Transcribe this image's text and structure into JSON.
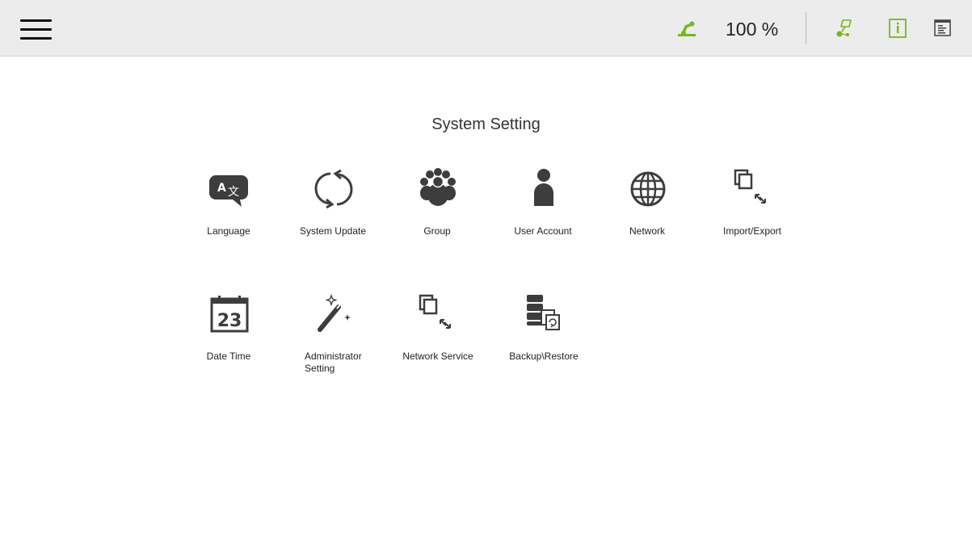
{
  "header": {
    "battery_level": "100 %"
  },
  "icons": {
    "menu": "hamburger-icon",
    "robot": "robot-arm-icon",
    "flow": "flow-icon",
    "info": "info-icon",
    "log": "log-window-icon"
  },
  "colors": {
    "accent": "#7ab51d",
    "icon_dark": "#3d3d3d",
    "topbar": "#ececec"
  },
  "page": {
    "title": "System Setting"
  },
  "settings": [
    {
      "label": "Language"
    },
    {
      "label": "System Update"
    },
    {
      "label": "Group"
    },
    {
      "label": "User Account"
    },
    {
      "label": "Network"
    },
    {
      "label": "Import/Export"
    },
    {
      "label": "Date Time",
      "date_number": "23"
    },
    {
      "label": "Administrator Setting"
    },
    {
      "label": "Network Service"
    },
    {
      "label": "Backup\\Restore"
    }
  ]
}
